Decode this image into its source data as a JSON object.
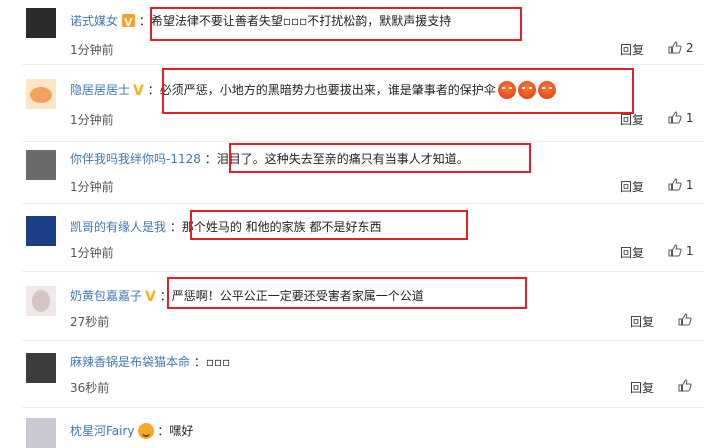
{
  "comments": [
    {
      "username": "诺式媒女",
      "badge": "vip-badge",
      "text": "希望法律不要让善者失望▫▫▫不打扰松韵，默默声援支持",
      "time": "1分钟前",
      "reply": "回复",
      "likes": "2",
      "avatar_color": "#2b2b2b"
    },
    {
      "username": "隐居居居士",
      "badge": "v-mark",
      "text": "必须严惩，小地方的黑暗势力也要拔出来，谁是肇事者的保护伞",
      "emoji_icons": [
        "angry-face-icon",
        "angry-face-icon",
        "angry-face-icon"
      ],
      "time": "1分钟前",
      "reply": "回复",
      "likes": "1",
      "avatar_color": "#f2a25c"
    },
    {
      "username": "你伴我吗我绊你吗-1128",
      "text": "泪目了。这种失去至亲的痛只有当事人才知道。",
      "time": "1分钟前",
      "reply": "回复",
      "likes": "1",
      "avatar_color": "#6b6b6b"
    },
    {
      "username": "凯哥的有缘人是我",
      "text": "那个姓马的 和他的家族 都不是好东西",
      "time": "1分钟前",
      "reply": "回复",
      "likes": "1",
      "avatar_color": "#1b3f86"
    },
    {
      "username": "奶黄包嘉嘉子",
      "badge": "v-mark",
      "text": "严惩啊！公平公正一定要还受害者家属一个公道",
      "time": "27秒前",
      "reply": "回复",
      "avatar_color": "#d7c4c6"
    },
    {
      "username": "麻辣香锅是布袋猫本命",
      "text": "▫▫▫",
      "time": "36秒前",
      "reply": "回复",
      "avatar_color": "#3d3d3d"
    },
    {
      "username": "枕星河Fairy",
      "emoji_icon": "smile-emoji-icon",
      "text": "嘿好",
      "avatar_color": "#a9a9b3"
    }
  ],
  "colon": "：",
  "colors": {
    "highlight": "#e2202a",
    "username": "#3f78b4",
    "vip": "#ff9b2f"
  }
}
